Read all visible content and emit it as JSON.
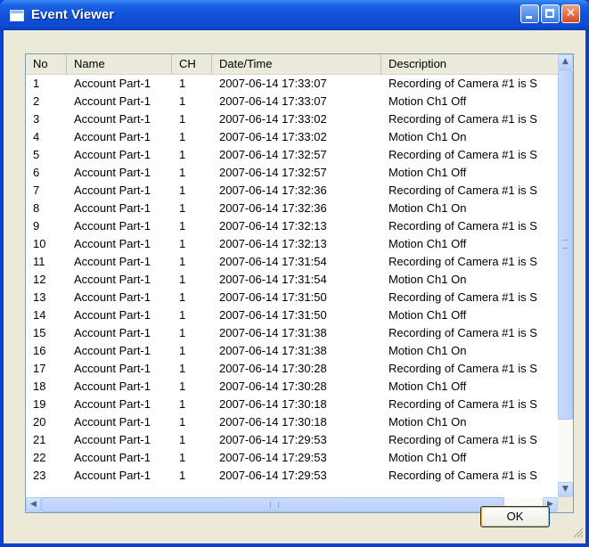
{
  "window": {
    "title": "Event Viewer",
    "icon": "window-icon"
  },
  "list": {
    "columns": [
      "No",
      "Name",
      "CH",
      "Date/Time",
      "Description"
    ],
    "rows": [
      [
        "1",
        "Account Part-1",
        "1",
        "2007-06-14 17:33:07",
        "Recording of Camera #1 is S"
      ],
      [
        "2",
        "Account Part-1",
        "1",
        "2007-06-14 17:33:07",
        "Motion Ch1 Off"
      ],
      [
        "3",
        "Account Part-1",
        "1",
        "2007-06-14 17:33:02",
        "Recording of Camera #1 is S"
      ],
      [
        "4",
        "Account Part-1",
        "1",
        "2007-06-14 17:33:02",
        "Motion Ch1 On"
      ],
      [
        "5",
        "Account Part-1",
        "1",
        "2007-06-14 17:32:57",
        "Recording of Camera #1 is S"
      ],
      [
        "6",
        "Account Part-1",
        "1",
        "2007-06-14 17:32:57",
        "Motion Ch1 Off"
      ],
      [
        "7",
        "Account Part-1",
        "1",
        "2007-06-14 17:32:36",
        "Recording of Camera #1 is S"
      ],
      [
        "8",
        "Account Part-1",
        "1",
        "2007-06-14 17:32:36",
        "Motion Ch1 On"
      ],
      [
        "9",
        "Account Part-1",
        "1",
        "2007-06-14 17:32:13",
        "Recording of Camera #1 is S"
      ],
      [
        "10",
        "Account Part-1",
        "1",
        "2007-06-14 17:32:13",
        "Motion Ch1 Off"
      ],
      [
        "11",
        "Account Part-1",
        "1",
        "2007-06-14 17:31:54",
        "Recording of Camera #1 is S"
      ],
      [
        "12",
        "Account Part-1",
        "1",
        "2007-06-14 17:31:54",
        "Motion Ch1 On"
      ],
      [
        "13",
        "Account Part-1",
        "1",
        "2007-06-14 17:31:50",
        "Recording of Camera #1 is S"
      ],
      [
        "14",
        "Account Part-1",
        "1",
        "2007-06-14 17:31:50",
        "Motion Ch1 Off"
      ],
      [
        "15",
        "Account Part-1",
        "1",
        "2007-06-14 17:31:38",
        "Recording of Camera #1 is S"
      ],
      [
        "16",
        "Account Part-1",
        "1",
        "2007-06-14 17:31:38",
        "Motion Ch1 On"
      ],
      [
        "17",
        "Account Part-1",
        "1",
        "2007-06-14 17:30:28",
        "Recording of Camera #1 is S"
      ],
      [
        "18",
        "Account Part-1",
        "1",
        "2007-06-14 17:30:28",
        "Motion Ch1 Off"
      ],
      [
        "19",
        "Account Part-1",
        "1",
        "2007-06-14 17:30:18",
        "Recording of Camera #1 is S"
      ],
      [
        "20",
        "Account Part-1",
        "1",
        "2007-06-14 17:30:18",
        "Motion Ch1 On"
      ],
      [
        "21",
        "Account Part-1",
        "1",
        "2007-06-14 17:29:53",
        "Recording of Camera #1 is S"
      ],
      [
        "22",
        "Account Part-1",
        "1",
        "2007-06-14 17:29:53",
        "Motion Ch1 Off"
      ],
      [
        "23",
        "Account Part-1",
        "1",
        "2007-06-14 17:29:53",
        "Recording of Camera #1 is S"
      ]
    ]
  },
  "buttons": {
    "ok": "OK"
  },
  "icons": {
    "minimize": "minimize-icon",
    "maximize": "maximize-icon",
    "close": "close-icon",
    "scroll_up": "arrow-up-icon",
    "scroll_down": "arrow-down-icon",
    "scroll_left": "arrow-left-icon",
    "scroll_right": "arrow-right-icon",
    "resize": "resize-grip-icon"
  },
  "colors": {
    "titlebar": "#0f50d6",
    "client": "#ece9d8",
    "close_button": "#d84820"
  }
}
